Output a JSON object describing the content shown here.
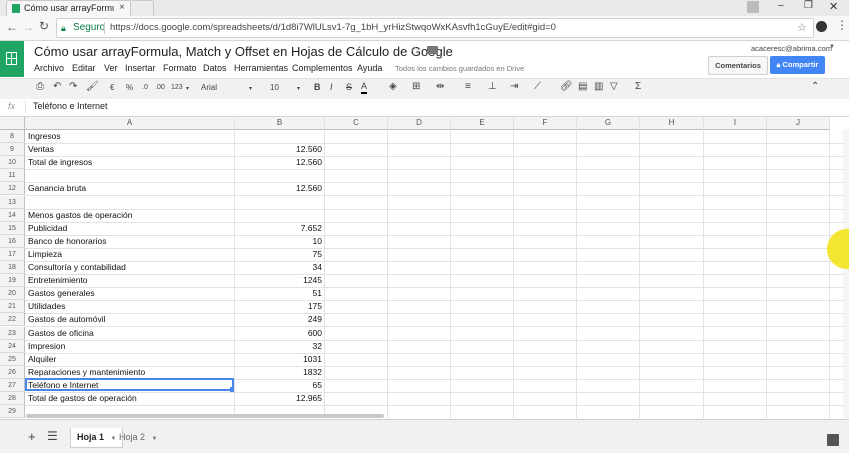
{
  "browser": {
    "tab_title": "Cómo usar arrayFormula",
    "secure_label": "Seguro",
    "url": "https://docs.google.com/spreadsheets/d/1d8i7WlULsv1-7g_1bH_yrHizStwqoWxKAsvfh1cGuyE/edit#gid=0"
  },
  "doc": {
    "title": "Cómo usar arrayFormula, Match y Offset en Hojas de Cálculo de Google",
    "account": "acaceresc@abrima.com",
    "comments_label": "Comentarios",
    "share_label": "Compartir",
    "menus": [
      "Archivo",
      "Editar",
      "Ver",
      "Insertar",
      "Formato",
      "Datos",
      "Herramientas",
      "Complementos",
      "Ayuda"
    ],
    "save_status": "Todos los cambios guardados en Drive"
  },
  "toolbar": {
    "currency": "€",
    "percent": "%",
    "dec_less": ".0",
    "dec_more": ".00",
    "more_formats": "123",
    "font": "Arial",
    "font_size": "10",
    "bold": "B",
    "italic": "I",
    "strike": "S",
    "text_color": "A",
    "sum": "Σ"
  },
  "formula_bar": {
    "fx": "fx",
    "value": "Teléfono e Internet"
  },
  "grid": {
    "columns": [
      "A",
      "B",
      "C",
      "D",
      "E",
      "F",
      "G",
      "H",
      "I",
      "J"
    ],
    "rows": [
      {
        "n": "8",
        "a": "Ingresos",
        "b": ""
      },
      {
        "n": "9",
        "a": "Ventas",
        "b": "12.560"
      },
      {
        "n": "10",
        "a": "Total de ingresos",
        "b": "12.560"
      },
      {
        "n": "11",
        "a": "",
        "b": ""
      },
      {
        "n": "12",
        "a": "Ganancia bruta",
        "b": "12.560"
      },
      {
        "n": "13",
        "a": "",
        "b": ""
      },
      {
        "n": "14",
        "a": "Menos gastos de operación",
        "b": ""
      },
      {
        "n": "15",
        "a": "Publicidad",
        "b": "7.652"
      },
      {
        "n": "16",
        "a": "Banco de honorarios",
        "b": "10"
      },
      {
        "n": "17",
        "a": "Limpieza",
        "b": "75"
      },
      {
        "n": "18",
        "a": "Consultoría y contabilidad",
        "b": "34"
      },
      {
        "n": "19",
        "a": "Entretenimiento",
        "b": "1245"
      },
      {
        "n": "20",
        "a": "Gastos generales",
        "b": "51"
      },
      {
        "n": "21",
        "a": "Utilidades",
        "b": "175"
      },
      {
        "n": "22",
        "a": "Gastos de automóvil",
        "b": "249"
      },
      {
        "n": "23",
        "a": "Gastos de oficina",
        "b": "600"
      },
      {
        "n": "24",
        "a": "Impresion",
        "b": "32"
      },
      {
        "n": "25",
        "a": "Alquiler",
        "b": "1031"
      },
      {
        "n": "26",
        "a": "Reparaciones y mantenimiento",
        "b": "1832"
      },
      {
        "n": "27",
        "a": "Teléfono e Internet",
        "b": "65"
      },
      {
        "n": "28",
        "a": "Total de gastos de operación",
        "b": "12.965"
      },
      {
        "n": "29",
        "a": "",
        "b": ""
      }
    ],
    "selected_row": "27"
  },
  "sheets": {
    "add": "+",
    "tabs": [
      "Hoja 1",
      "Hoja 2"
    ],
    "active": "Hoja 1"
  },
  "colors": {
    "brand_green": "#1fa463",
    "share_blue": "#4285f4",
    "selection_blue": "#4a86e8"
  }
}
